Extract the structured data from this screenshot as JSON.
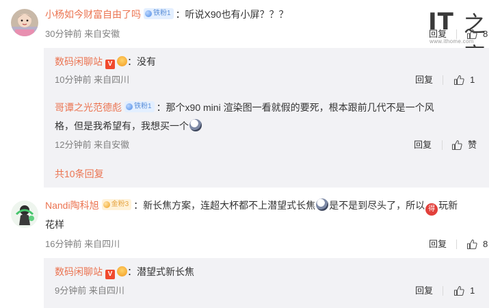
{
  "watermark": {
    "logo_it": "IT",
    "logo_cn": "之家",
    "url": "www.ithome.com"
  },
  "comments": [
    {
      "username": "小杨如今财富自由了吗",
      "badge": "铁粉1",
      "text": "：听说X90也有小屏？？？",
      "time": "30分钟前",
      "location": "来自安徽",
      "reply_label": "回复",
      "like_count": "8",
      "replies": [
        {
          "username": "数码闲聊站",
          "text": "：没有",
          "time": "10分钟前",
          "location": "来自四川",
          "reply_label": "回复",
          "like_count": "1"
        },
        {
          "username": "哥谭之光范德彪",
          "badge": "铁粉1",
          "text_line1": "：那个x90 mini 渲染图一看就假的要死，根本跟前几代不是一个风",
          "text_line2": "格，但是我希望有，我想买一个",
          "time": "12分钟前",
          "location": "来自安徽",
          "reply_label": "回复",
          "like_label": "赞"
        }
      ],
      "more_replies": "共10条回复"
    },
    {
      "username": "Nandi陶科旭",
      "badge": "金粉3",
      "text_line1a": "：新长焦方案，连超大杯都不上潜望式长焦",
      "text_line1b": "是不是到尽头了，所以",
      "text_line1c": "玩新",
      "emoji_de": "得",
      "text_line2": "花样",
      "time": "16分钟前",
      "location": "来自四川",
      "reply_label": "回复",
      "like_count": "8",
      "replies": [
        {
          "username": "数码闲聊站",
          "text": "：潜望式新长焦",
          "time": "9分钟前",
          "location": "来自四川",
          "reply_label": "回复",
          "like_count": "1"
        }
      ]
    }
  ]
}
